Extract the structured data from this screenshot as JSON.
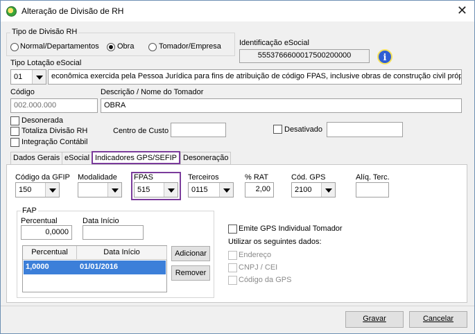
{
  "window": {
    "title": "Alteração de Divisão de RH"
  },
  "tipo_divisao": {
    "legend": "Tipo de Divisão RH",
    "options": [
      "Normal/Departamentos",
      "Obra",
      "Tomador/Empresa"
    ],
    "selected": "Obra"
  },
  "identificacao": {
    "label": "Identificação eSocial",
    "value": "5553766600017500200000"
  },
  "tipo_lotacao": {
    "label": "Tipo Lotação eSocial",
    "code": "01",
    "description": "econômica exercida pela Pessoa Jurídica para fins de atribuição de código FPAS, inclusive obras de construção civil própria"
  },
  "codigo": {
    "label": "Código",
    "value": "002.000.000"
  },
  "descricao": {
    "label": "Descrição / Nome do Tomador",
    "value": "OBRA"
  },
  "checks": {
    "desonerada": "Desonerada",
    "totaliza": "Totaliza Divisão RH",
    "integracao": "Integração Contábil",
    "desativado": "Desativado"
  },
  "centro_custo": {
    "label": "Centro de Custo",
    "value": ""
  },
  "tabs": [
    "Dados Gerais",
    "eSocial",
    "Indicadores GPS/SEFIP",
    "Desoneração"
  ],
  "gps": {
    "codigo_gfip": {
      "label": "Código da GFIP",
      "value": "150"
    },
    "modalidade": {
      "label": "Modalidade",
      "value": ""
    },
    "fpas": {
      "label": "FPAS",
      "value": "515"
    },
    "terceiros": {
      "label": "Terceiros",
      "value": "0115"
    },
    "rat": {
      "label": "% RAT",
      "value": "2,00"
    },
    "cod_gps": {
      "label": "Cód. GPS",
      "value": "2100"
    },
    "aliq_terc": {
      "label": "Alíq. Terc.",
      "value": ""
    }
  },
  "fap": {
    "legend": "FAP",
    "percentual_label": "Percentual",
    "percentual_value": "0,0000",
    "data_inicio_label": "Data Início",
    "data_inicio_value": "",
    "columns": [
      "Percentual",
      "Data Início"
    ],
    "rows": [
      {
        "percentual": "1,0000",
        "data_inicio": "01/01/2016"
      }
    ],
    "add_label": "Adicionar",
    "remove_label": "Remover"
  },
  "emite": {
    "label": "Emite GPS Individual Tomador",
    "utilizar": "Utilizar os seguintes dados:",
    "endereco": "Endereço",
    "cnpj": "CNPJ / CEI",
    "codigo_gps": "Código da GPS"
  },
  "footer": {
    "save": "Gravar",
    "cancel": "Cancelar"
  },
  "colors": {
    "highlight": "#7a3b9b",
    "selection": "#3c7fd9"
  }
}
